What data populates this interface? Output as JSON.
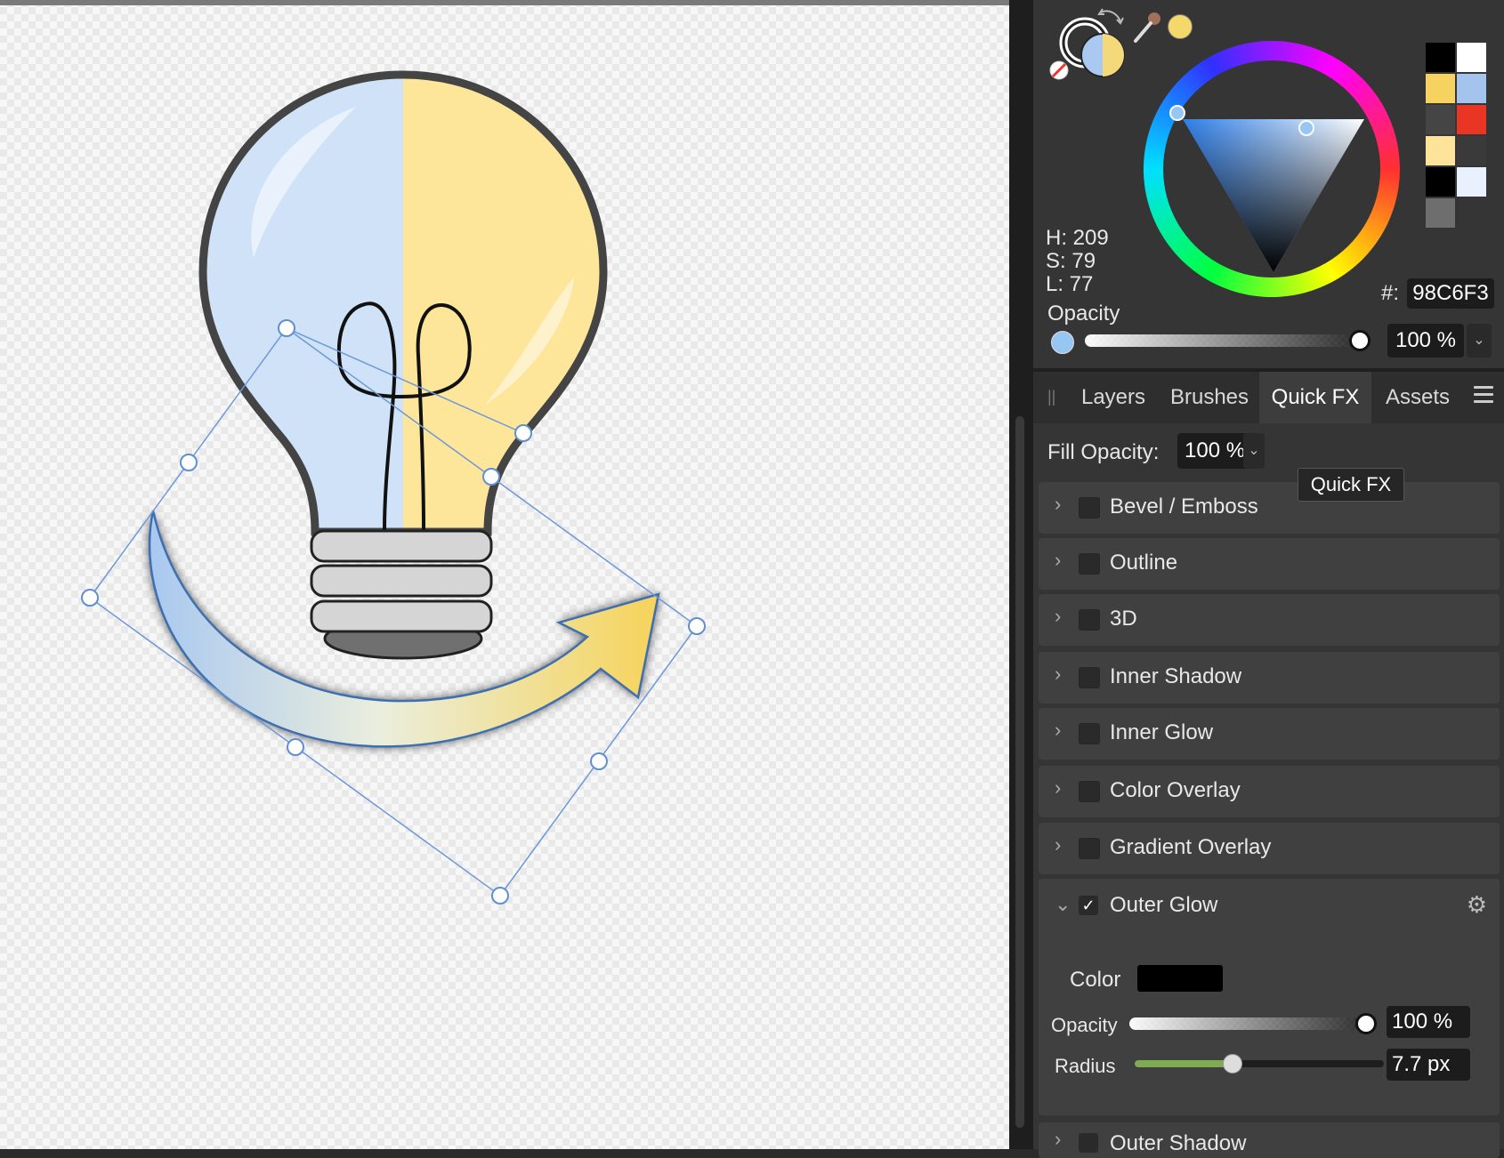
{
  "color_panel": {
    "h": "H: 209",
    "s": "S: 79",
    "l": "L: 77",
    "hex_label": "#:",
    "hex_value": "98C6F3",
    "opacity_label": "Opacity",
    "opacity_value": "100 %",
    "current_color": "#98C6F3",
    "swatches": [
      "#000000",
      "#ffffff",
      "#f6d260",
      "#a4c4ee",
      "#454545",
      "#e83524",
      "#fde49a",
      "#3a3a3a",
      "#000000",
      "#e8f1fd",
      "#6e6e6e"
    ]
  },
  "tabs": {
    "layers": "Layers",
    "brushes": "Brushes",
    "quickfx": "Quick FX",
    "assets": "Assets"
  },
  "fill_opacity": {
    "label": "Fill Opacity:",
    "value": "100 %"
  },
  "tooltip": "Quick FX",
  "effects": {
    "bevel": "Bevel / Emboss",
    "outline": "Outline",
    "three_d": "3D",
    "inner_shadow": "Inner Shadow",
    "inner_glow": "Inner Glow",
    "color_overlay": "Color Overlay",
    "gradient_overlay": "Gradient Overlay",
    "outer_glow": "Outer Glow",
    "outer_shadow": "Outer Shadow"
  },
  "outer_glow": {
    "color_label": "Color",
    "color_value": "#000000",
    "opacity_label": "Opacity",
    "opacity_value": "100 %",
    "radius_label": "Radius",
    "radius_value": "7.7 px",
    "radius_fraction": 0.39,
    "checked": "✓"
  }
}
